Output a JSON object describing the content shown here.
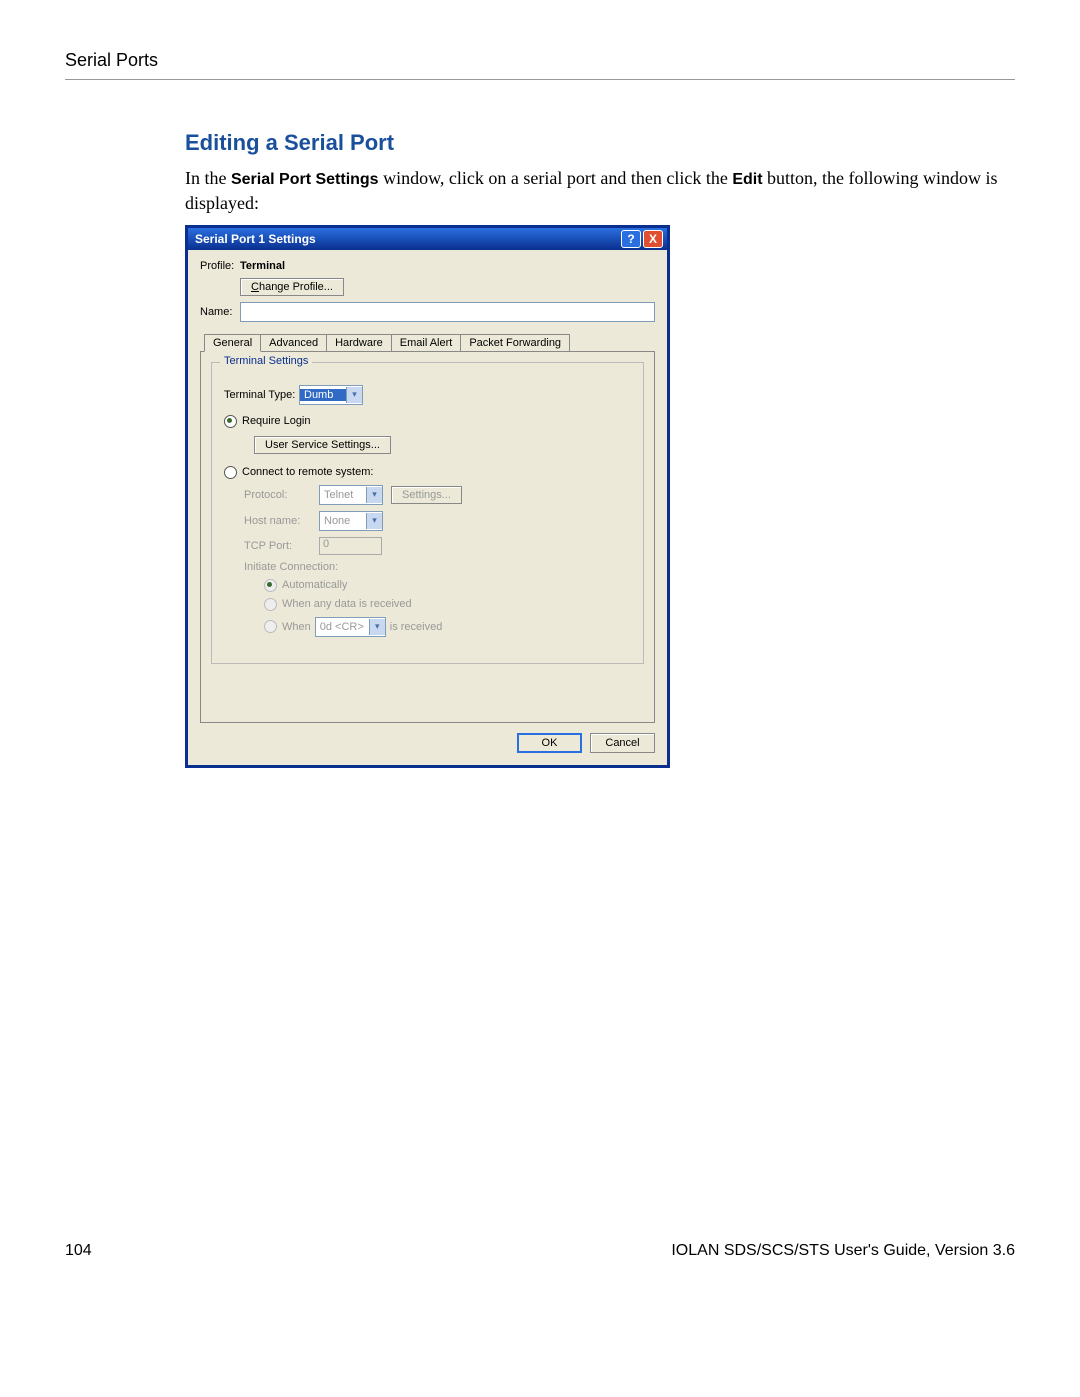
{
  "header": {
    "section": "Serial Ports"
  },
  "section": {
    "heading": "Editing a Serial Port",
    "p1a": "In the ",
    "bold1": "Serial Port Settings",
    "p1b": " window, click on a serial port and then click the ",
    "bold2": "Edit",
    "p1c": " button, the following window is displayed:"
  },
  "dialog": {
    "title": "Serial Port 1 Settings",
    "profile_label": "Profile:",
    "profile_value": "Terminal",
    "change_profile_u": "C",
    "change_profile_rest": "hange Profile...",
    "name_label": "Name:",
    "tabs": [
      "General",
      "Advanced",
      "Hardware",
      "Email Alert",
      "Packet Forwarding"
    ],
    "group_title": "Terminal Settings",
    "terminal_type_label": "Terminal Type:",
    "terminal_type_value": "Dumb",
    "require_login": "Require Login",
    "user_service_btn": "User Service Settings...",
    "connect_remote": "Connect to remote system:",
    "protocol_label": "Protocol:",
    "protocol_value": "Telnet",
    "settings_btn": "Settings...",
    "hostname_label": "Host name:",
    "hostname_value": "None",
    "tcp_port_label": "TCP Port:",
    "tcp_port_value": "0",
    "initiate_label": "Initiate Connection:",
    "init_auto": "Automatically",
    "init_anydata": "When any data is received",
    "init_when": "When",
    "init_when_value": "0d <CR>",
    "init_when_suffix": "is received",
    "ok": "OK",
    "cancel": "Cancel"
  },
  "footer": {
    "page": "104",
    "text": "IOLAN SDS/SCS/STS User's Guide, Version 3.6"
  }
}
